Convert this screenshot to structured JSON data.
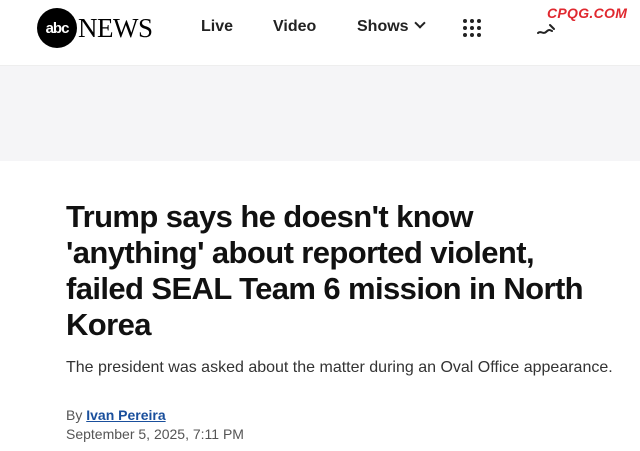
{
  "header": {
    "logo": {
      "circle_text": "abc",
      "wordmark": "NEWS"
    },
    "nav": [
      {
        "label": "Live"
      },
      {
        "label": "Video"
      },
      {
        "label": "Shows"
      }
    ],
    "watermark": "CPQG.COM"
  },
  "article": {
    "headline": "Trump says he doesn't know 'anything' about reported violent, failed SEAL Team 6 mission in North Korea",
    "subheadline": "The president was asked about the matter during an Oval Office appearance.",
    "byline_prefix": "By",
    "author": "Ivan Pereira",
    "date": "September 5, 2025, 7:11 PM"
  },
  "colors": {
    "ad_band_background": "#f5f5f7",
    "author_link": "#1a4f9c",
    "watermark": "#e0282f"
  }
}
